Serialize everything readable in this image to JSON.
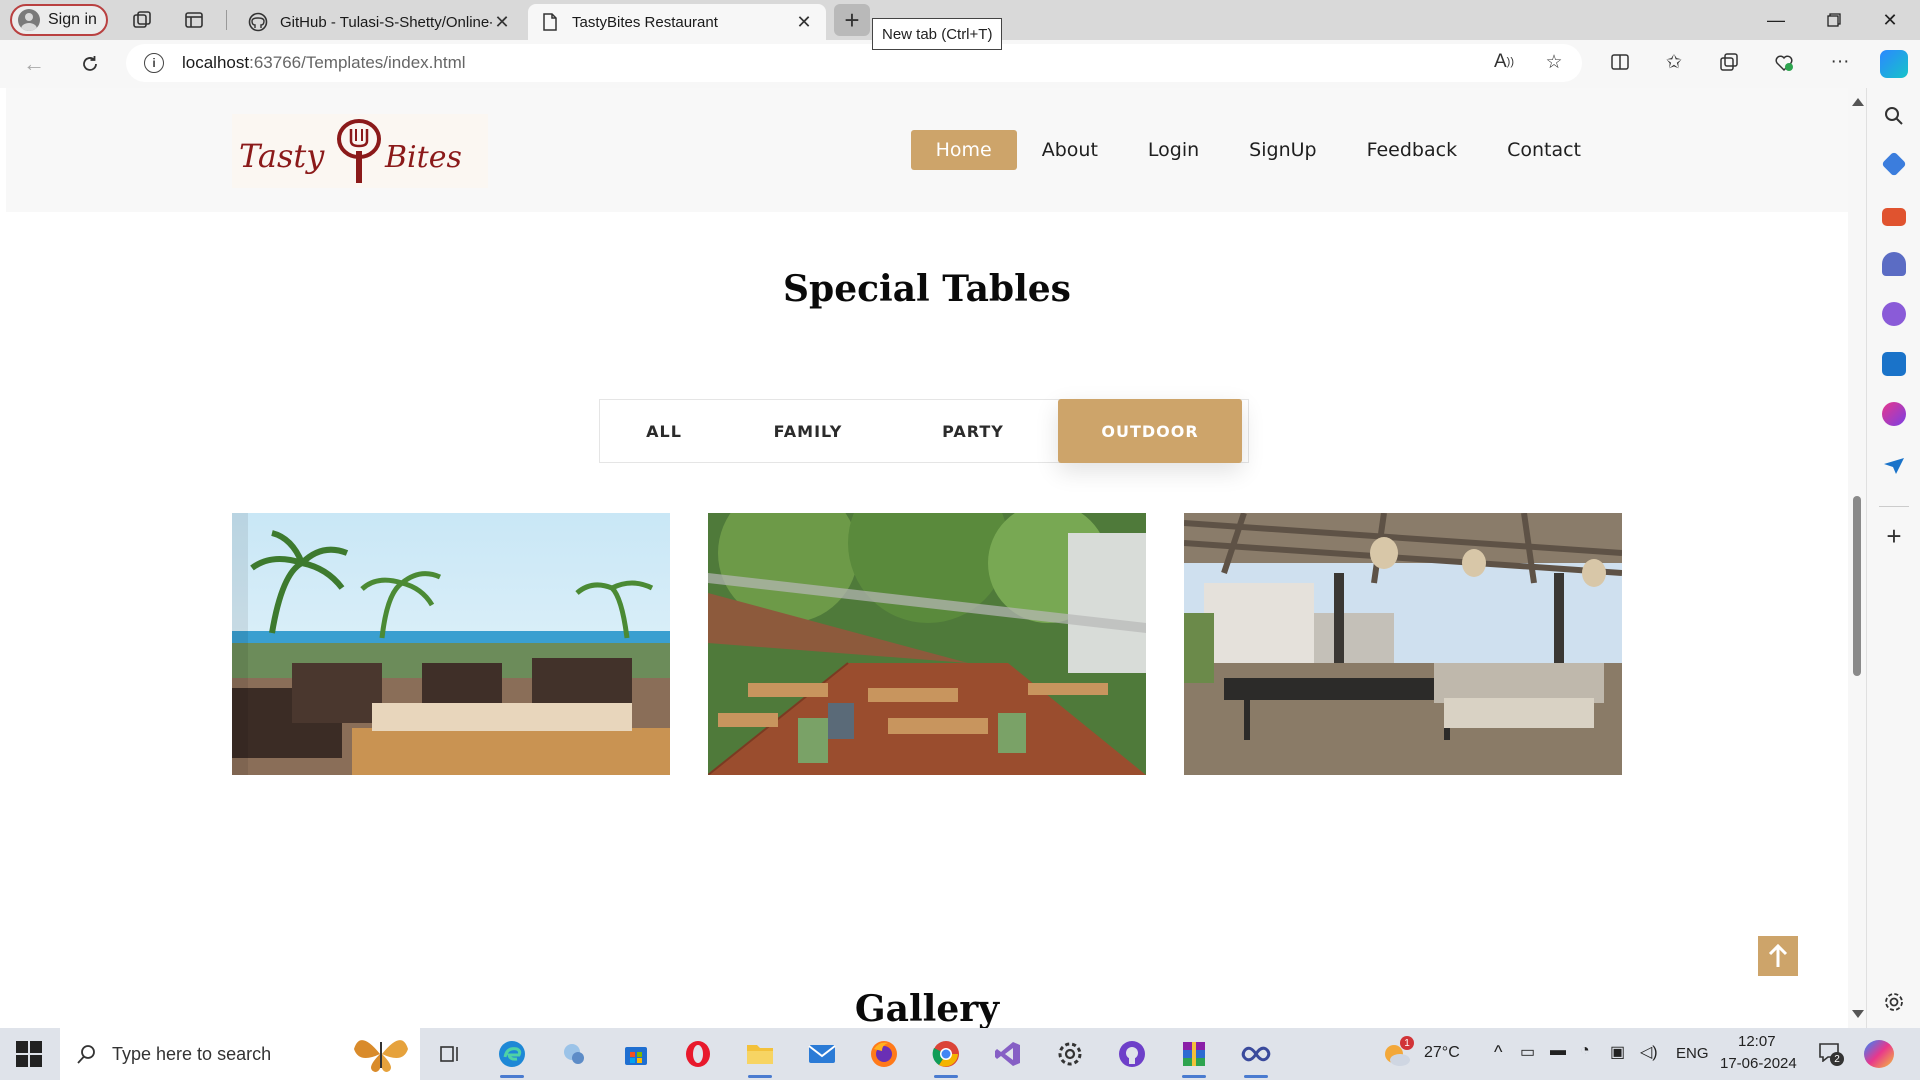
{
  "browser": {
    "signin_label": "Sign in",
    "tabs": [
      {
        "title": "GitHub - Tulasi-S-Shetty/Online-",
        "active": false
      },
      {
        "title": "TastyBites Restaurant",
        "active": true
      }
    ],
    "newtab_tooltip": "New tab (Ctrl+T)",
    "url_host": "localhost",
    "url_rest": ":63766/Templates/index.html"
  },
  "site": {
    "logo_text_left": "Tasty",
    "logo_text_right": "Bites",
    "nav": [
      {
        "label": "Home",
        "active": true
      },
      {
        "label": "About",
        "active": false
      },
      {
        "label": "Login",
        "active": false
      },
      {
        "label": "SignUp",
        "active": false
      },
      {
        "label": "Feedback",
        "active": false
      },
      {
        "label": "Contact",
        "active": false
      }
    ],
    "special_title": "Special Tables",
    "filters": [
      {
        "label": "ALL",
        "active": false
      },
      {
        "label": "FAMILY",
        "active": false
      },
      {
        "label": "PARTY",
        "active": false
      },
      {
        "label": "OUTDOOR",
        "active": true
      }
    ],
    "photos": [
      "beachside-terrace",
      "wooden-deck-patio",
      "rooftop-pergola"
    ],
    "gallery_title": "Gallery",
    "accent_color": "#cda46a"
  },
  "taskbar": {
    "search_placeholder": "Type here to search",
    "weather": "27°C",
    "language": "ENG",
    "time": "12:07",
    "date": "17-06-2024",
    "notification_count": "2",
    "weather_badge": "1"
  }
}
